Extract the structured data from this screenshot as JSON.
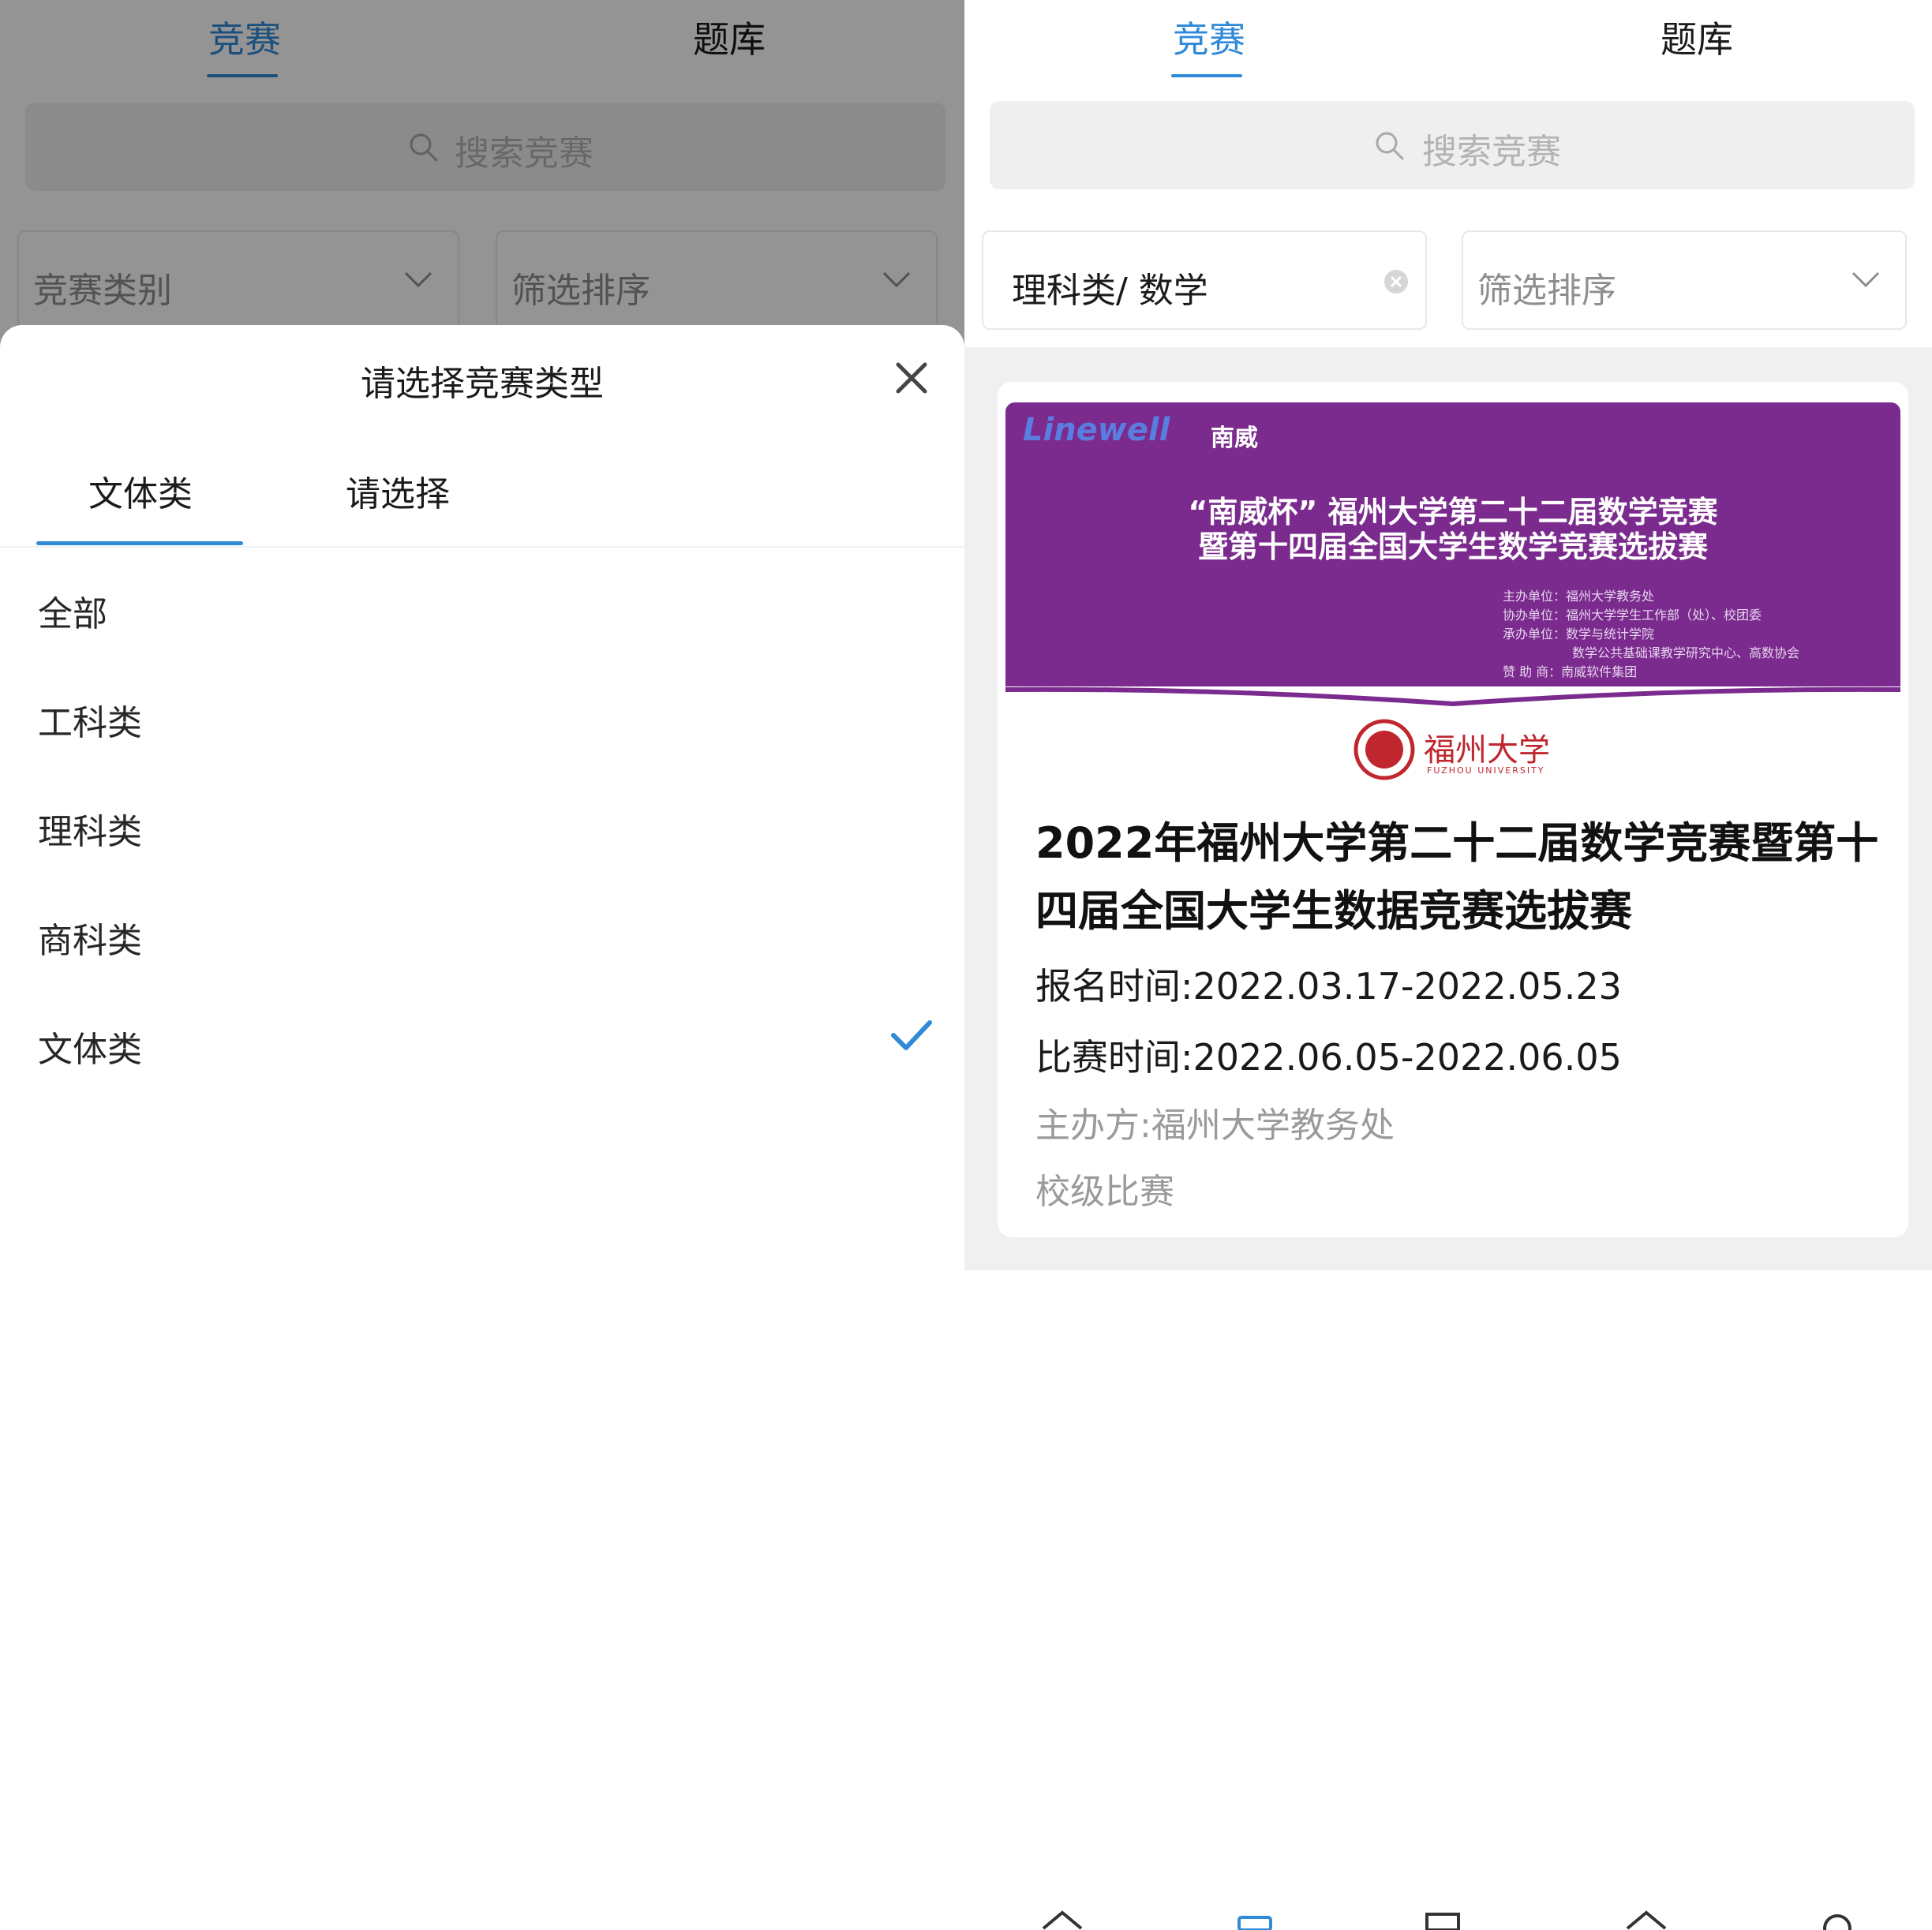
{
  "left": {
    "tabs": [
      "竞赛",
      "题库"
    ],
    "search_placeholder": "搜索竞赛",
    "filter_category": "竞赛类别",
    "filter_sort": "筛选排序",
    "sheet": {
      "title": "请选择竞赛类型",
      "tabs": [
        "文体类",
        "请选择"
      ],
      "options": [
        "全部",
        "工科类",
        "理科类",
        "商科类",
        "文体类"
      ],
      "selected": "文体类"
    },
    "nav_icons": [
      "home-icon",
      "competition-icon",
      "bank-icon",
      "message-icon",
      "profile-icon"
    ]
  },
  "right": {
    "tabs": [
      "竞赛",
      "题库"
    ],
    "search_placeholder": "搜索竞赛",
    "filter_category": "理科类/ 数学",
    "filter_sort": "筛选排序",
    "card": {
      "banner": {
        "logo": "Linewell",
        "logo_cn": "南威",
        "line1": "“南威杯” 福州大学第二十二届数学竞赛",
        "line2": "暨第十四届全国大学生数学竞赛选拔赛",
        "small_lines": [
          "主办单位：福州大学教务处",
          "协办单位：福州大学学生工作部（处）、校团委",
          "承办单位：数学与统计学院",
          "数学公共基础课教学研究中心、高数协会",
          "赞 助 商：南威软件集团"
        ],
        "university": "福州大学",
        "university_en": "FUZHOU UNIVERSITY",
        "colors": {
          "banner": "#7b2a8e",
          "seal": "#c0262e"
        }
      },
      "title": "2022年福州大学第二十二届数学竞赛暨第十四届全国大学生数据竞赛选拔赛",
      "signup_time": "报名时间:2022.03.17-2022.05.23",
      "match_time": "比赛时间:2022.06.05-2022.06.05",
      "organizer": "主办方:福州大学教务处",
      "level": "校级比赛"
    }
  },
  "colors": {
    "accent": "#2f8ad8"
  }
}
